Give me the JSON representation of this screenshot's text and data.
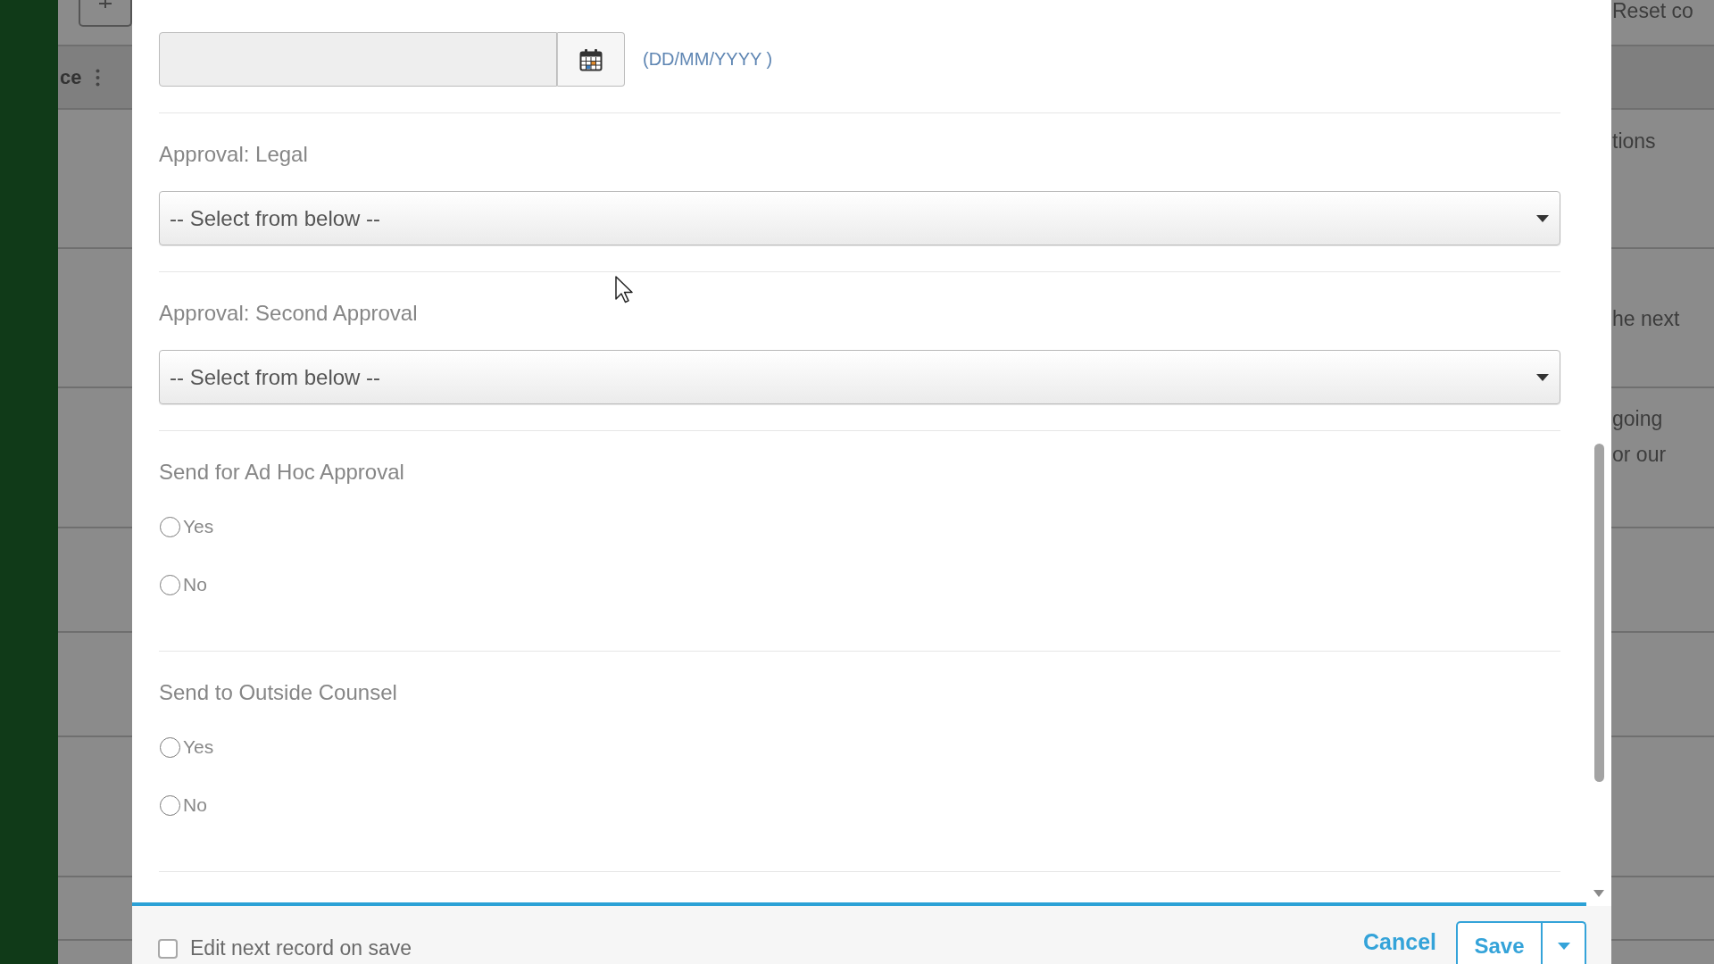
{
  "backdrop": {
    "left_header": "ce",
    "toolbar_text": "Reset co",
    "right_cells": [
      [
        "tions"
      ],
      [
        "he next"
      ],
      [
        "going",
        "or our"
      ]
    ]
  },
  "dialog": {
    "fields": [
      {
        "kind": "date",
        "hint": "(DD/MM/YYYY )"
      },
      {
        "kind": "select",
        "label": "Approval: Legal",
        "value": "-- Select from below --"
      },
      {
        "kind": "select",
        "label": "Approval: Second Approval",
        "value": "-- Select from below --"
      },
      {
        "kind": "radio",
        "label": "Send for Ad Hoc Approval",
        "options": [
          {
            "label": "Yes",
            "selected": false
          },
          {
            "label": "No",
            "selected": false
          }
        ]
      },
      {
        "kind": "radio",
        "label": "Send to Outside Counsel",
        "options": [
          {
            "label": "Yes",
            "selected": false
          },
          {
            "label": "No",
            "selected": false
          }
        ]
      }
    ],
    "footer": {
      "edit_next": {
        "label": "Edit next record on save",
        "checked": false
      },
      "cancel": "Cancel",
      "save": "Save"
    }
  }
}
